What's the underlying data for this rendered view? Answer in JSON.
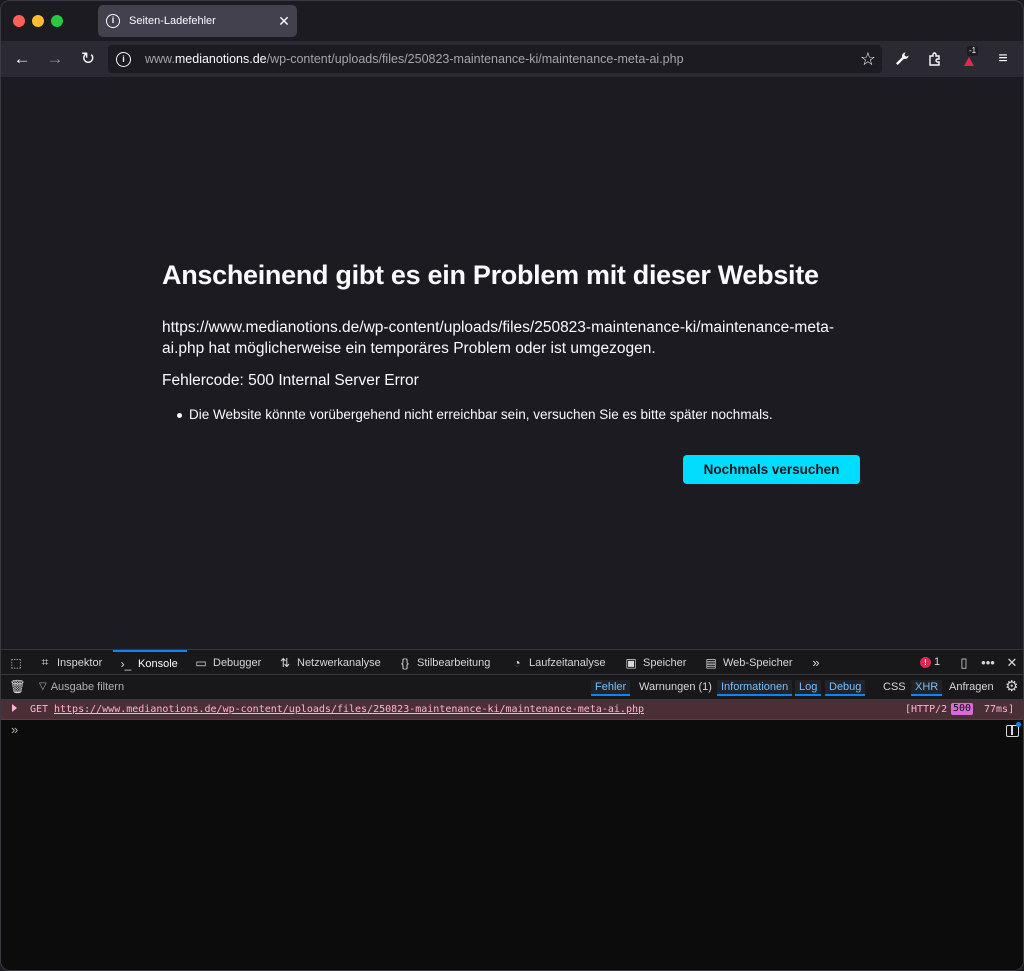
{
  "tab": {
    "title": "Seiten-Ladefehler",
    "close": "✕"
  },
  "nav": {
    "back": "←",
    "forward": "→",
    "reload": "↻",
    "url_prefix": "www.",
    "url_domain": "medianotions.de",
    "url_path": "/wp-content/uploads/files/250823-maintenance-ki/maintenance-meta-ai.php",
    "extension_badge": "-1"
  },
  "error_page": {
    "title": "Anscheinend gibt es ein Problem mit dieser Website",
    "description": "https://www.medianotions.de/wp-content/uploads/files/250823-maintenance-ki/maintenance-meta-ai.php hat möglicherweise ein temporäres Problem oder ist umgezogen.",
    "error_code": "Fehlercode: 500 Internal Server Error",
    "hint": "Die Website könnte vorübergehend nicht erreichbar sein, versuchen Sie es bitte später nochmals.",
    "retry_label": "Nochmals versuchen"
  },
  "devtools": {
    "tabs": [
      {
        "label": "Inspektor",
        "icon": "inspector-icon"
      },
      {
        "label": "Konsole",
        "icon": "console-icon"
      },
      {
        "label": "Debugger",
        "icon": "debugger-icon"
      },
      {
        "label": "Netzwerkanalyse",
        "icon": "network-icon"
      },
      {
        "label": "Stilbearbeitung",
        "icon": "style-editor-icon"
      },
      {
        "label": "Laufzeitanalyse",
        "icon": "performance-icon"
      },
      {
        "label": "Speicher",
        "icon": "memory-icon"
      },
      {
        "label": "Web-Speicher",
        "icon": "storage-icon"
      }
    ],
    "selected_tab": "Konsole",
    "error_count": "1",
    "filter_placeholder": "Ausgabe filtern",
    "filters": {
      "fehler": "Fehler",
      "warnungen": "Warnungen (1)",
      "informationen": "Informationen",
      "log": "Log",
      "debug": "Debug",
      "css": "CSS",
      "xhr": "XHR",
      "anfragen": "Anfragen"
    },
    "console_entry": {
      "method": "GET",
      "url": "https://www.medianotions.de/wp-content/uploads/files/250823-maintenance-ki/maintenance-meta-ai.php",
      "protocol": "[HTTP/2",
      "status": "500",
      "time": "77ms]"
    },
    "prompt": "»"
  },
  "colors": {
    "accent": "#00ddff",
    "devtools_selected": "#0a84ff",
    "error_row": "#4b2f36",
    "error_badge": "#e22850"
  }
}
